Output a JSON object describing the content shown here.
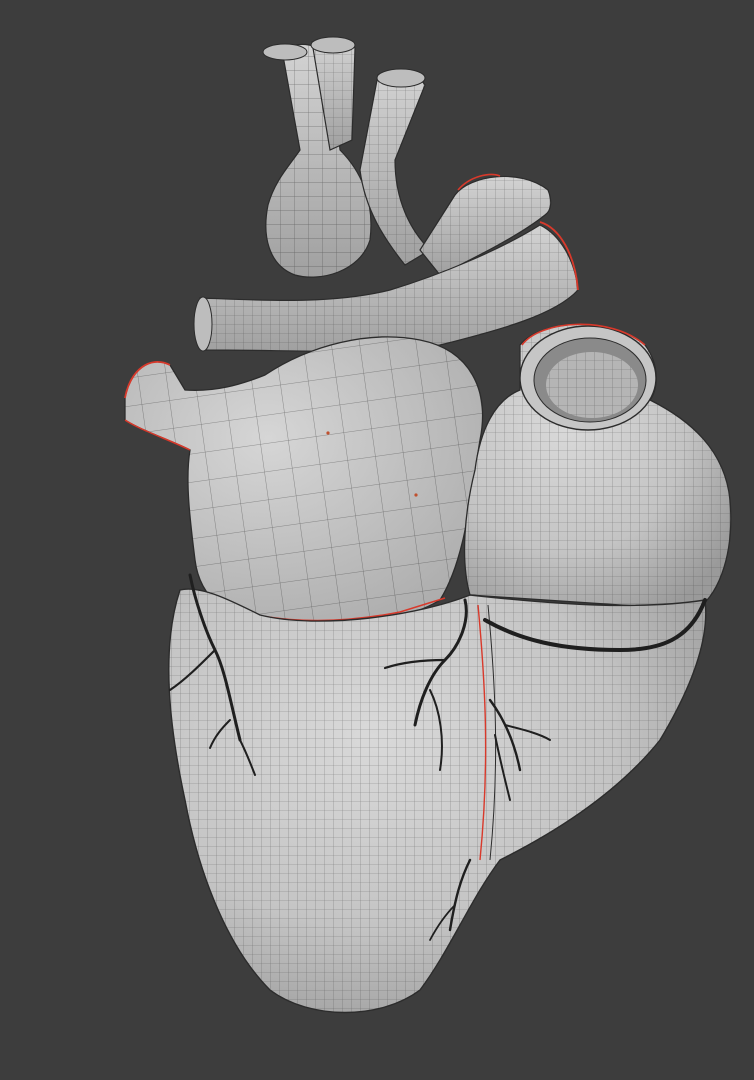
{
  "scene": {
    "subject": "heart-model-wireframe",
    "background_color": "#3d3d3d",
    "mesh_color": "#c9c9c9",
    "wire_color": "#2c2c2c",
    "seam_color": "#d8392b",
    "vessel_color": "#1f1f1f"
  }
}
